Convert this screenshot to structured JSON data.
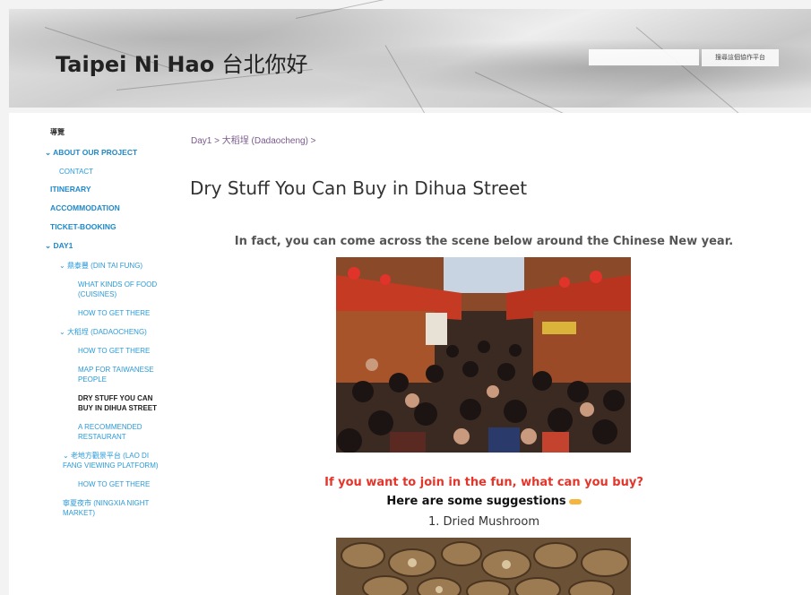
{
  "header": {
    "title_latin": "Taipei Ni Hao",
    "title_cjk": "台北你好",
    "search_button": "搜尋這個協作平台"
  },
  "nav": {
    "overview": "導覽",
    "about": "ABOUT OUR PROJECT",
    "contact": "CONTACT",
    "itinerary": "ITINERARY",
    "accommodation": "ACCOMMODATION",
    "ticket": "TICKET-BOOKING",
    "day1": "DAY1",
    "din_tai_fung": "鼎泰豐 (DIN TAI FUNG)",
    "food_kinds": "WHAT KINDS OF FOOD (CUISINES)",
    "how_get_1": "HOW TO GET THERE",
    "dadaocheng": "大稻埕 (DADAOCHENG)",
    "how_get_2": "HOW TO GET THERE",
    "map": "MAP FOR TAIWANESE PEOPLE",
    "dry_stuff": "DRY STUFF YOU CAN BUY IN DIHUA STREET",
    "restaurant": "A RECOMMENDED RESTAURANT",
    "lao_di": "老地方觀景平台 (LAO DI FANG VIEWING PLATFORM)",
    "how_get_3": "HOW TO GET THERE",
    "night_market": "寧夏夜市 (NINGXIA NIGHT MARKET)"
  },
  "main": {
    "breadcrumb": "Day1 > 大稻埕 (Dadaocheng) >",
    "title": "Dry Stuff You Can Buy in Dihua Street",
    "intro": "In fact, you can come across the scene below around the Chinese New year.",
    "cta": "If you want to join in the fun, what can you buy?",
    "suggestions": "Here are some suggestions",
    "item1": "1. Dried Mushroom"
  },
  "colors": {
    "nav_link": "#2a9ad8",
    "cta_red": "#e5352a",
    "breadcrumb": "#7a5a8c"
  }
}
